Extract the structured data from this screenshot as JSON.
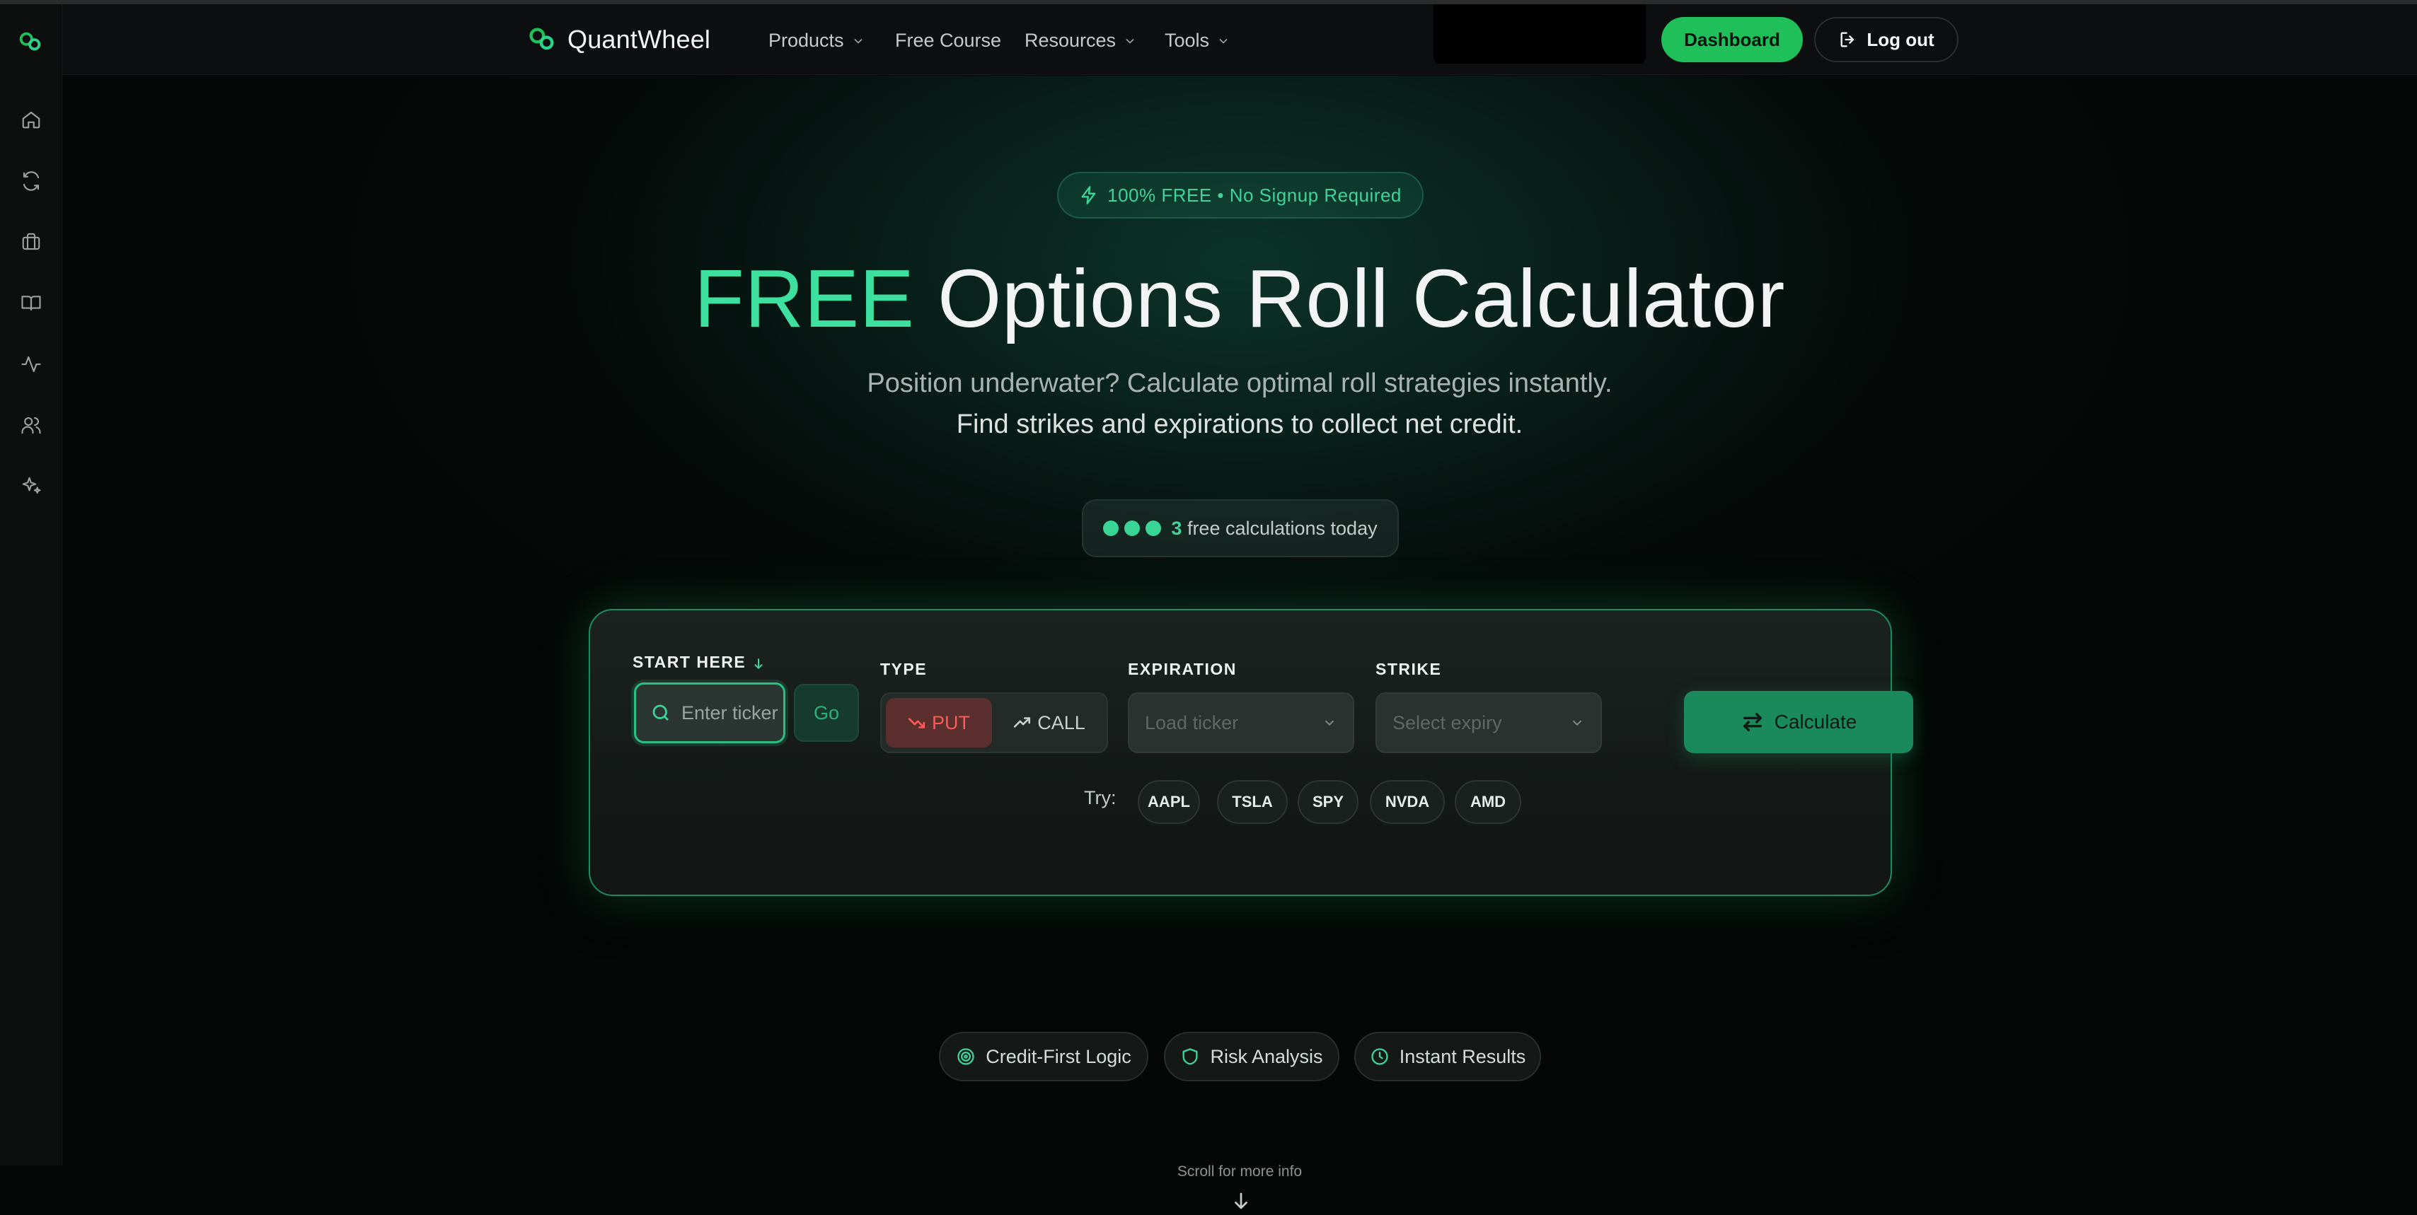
{
  "sidebar": {
    "items": [
      {
        "icon": "home-icon"
      },
      {
        "icon": "refresh-icon"
      },
      {
        "icon": "briefcase-icon"
      },
      {
        "icon": "book-icon"
      },
      {
        "icon": "activity-icon"
      },
      {
        "icon": "users-icon"
      },
      {
        "icon": "sparkles-icon"
      }
    ]
  },
  "navbar": {
    "brand": "QuantWheel",
    "items": [
      {
        "label": "Products",
        "dropdown": true
      },
      {
        "label": "Free Course",
        "dropdown": false
      },
      {
        "label": "Resources",
        "dropdown": true
      },
      {
        "label": "Tools",
        "dropdown": true
      }
    ],
    "dashboard_label": "Dashboard",
    "logout_label": "Log out"
  },
  "hero": {
    "badge": "100% FREE • No Signup Required",
    "title_accent": "FREE",
    "title_rest": "Options Roll Calculator",
    "subtitle_1": "Position underwater? Calculate optimal roll strategies instantly.",
    "subtitle_2": "Find strikes and expirations to collect net credit.",
    "calc_count": "3",
    "calc_text": "free calculations today"
  },
  "form": {
    "start_label": "START HERE",
    "ticker_placeholder": "Enter ticker",
    "go_label": "Go",
    "type_label": "TYPE",
    "put_label": "PUT",
    "call_label": "CALL",
    "selected_type": "PUT",
    "expiration_label": "EXPIRATION",
    "expiration_placeholder": "Load ticker",
    "strike_label": "STRIKE",
    "strike_placeholder": "Select expiry",
    "calculate_label": "Calculate",
    "try_label": "Try:",
    "tickers": [
      "AAPL",
      "TSLA",
      "SPY",
      "NVDA",
      "AMD"
    ]
  },
  "features": [
    "Credit-First Logic",
    "Risk Analysis",
    "Instant Results"
  ],
  "scroll_hint": "Scroll for more info",
  "colors": {
    "accent": "#3ee0a0",
    "primary_button": "#1fbf5a",
    "put": "#ff5a55",
    "calculate_button": "#1a8a5c"
  }
}
